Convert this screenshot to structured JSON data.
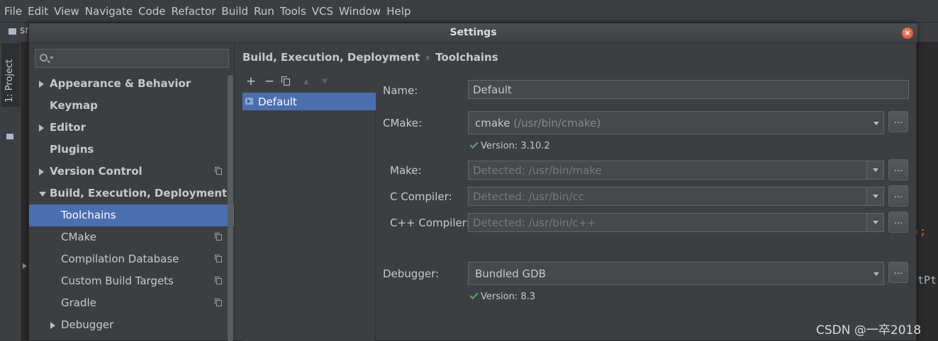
{
  "menubar": {
    "items": [
      "File",
      "Edit",
      "View",
      "Navigate",
      "Code",
      "Refactor",
      "Build",
      "Run",
      "Tools",
      "VCS",
      "Window",
      "Help"
    ]
  },
  "ide": {
    "breadcrumb_fragment": "sr",
    "project_tab_label": "1: Project",
    "editor_fragments": [
      ");",
      "tPt"
    ]
  },
  "dialog": {
    "title": "Settings",
    "close_glyph": "×"
  },
  "nav": {
    "items": [
      {
        "label": "Appearance & Behavior",
        "expander": "collapsed",
        "bold": true,
        "level": 0,
        "project_icon": false
      },
      {
        "label": "Keymap",
        "expander": "none",
        "bold": true,
        "level": 0,
        "project_icon": false
      },
      {
        "label": "Editor",
        "expander": "collapsed",
        "bold": true,
        "level": 0,
        "project_icon": false
      },
      {
        "label": "Plugins",
        "expander": "none",
        "bold": true,
        "level": 0,
        "project_icon": false
      },
      {
        "label": "Version Control",
        "expander": "collapsed",
        "bold": true,
        "level": 0,
        "project_icon": true
      },
      {
        "label": "Build, Execution, Deployment",
        "expander": "expanded",
        "bold": true,
        "level": 0,
        "project_icon": false
      },
      {
        "label": "Toolchains",
        "expander": "none",
        "bold": false,
        "level": 1,
        "project_icon": false,
        "selected": true
      },
      {
        "label": "CMake",
        "expander": "none",
        "bold": false,
        "level": 1,
        "project_icon": true
      },
      {
        "label": "Compilation Database",
        "expander": "none",
        "bold": false,
        "level": 1,
        "project_icon": true
      },
      {
        "label": "Custom Build Targets",
        "expander": "none",
        "bold": false,
        "level": 1,
        "project_icon": true
      },
      {
        "label": "Gradle",
        "expander": "none",
        "bold": false,
        "level": 1,
        "project_icon": true
      },
      {
        "label": "Debugger",
        "expander": "collapsed",
        "bold": false,
        "level": 1,
        "project_icon": false
      }
    ]
  },
  "breadcrumb": {
    "parent": "Build, Execution, Deployment",
    "separator": "›",
    "current": "Toolchains"
  },
  "toolchains": {
    "toolbar": {
      "add": "+",
      "remove": "−",
      "up": "▲",
      "down": "▼"
    },
    "items": [
      {
        "label": "Default",
        "selected": true
      }
    ]
  },
  "form": {
    "name": {
      "label": "Name:",
      "value": "Default"
    },
    "cmake": {
      "label": "CMake:",
      "value": "cmake",
      "hint": "(/usr/bin/cmake)",
      "browse": "...",
      "version": "Version: 3.10.2"
    },
    "make": {
      "label": "Make:",
      "placeholder": "Detected: /usr/bin/make",
      "browse": "..."
    },
    "c_compiler": {
      "label": "C Compiler:",
      "placeholder": "Detected: /usr/bin/cc",
      "browse": "..."
    },
    "cpp_compiler": {
      "label": "C++ Compiler:",
      "placeholder": "Detected: /usr/bin/c++",
      "browse": "..."
    },
    "debugger": {
      "label": "Debugger:",
      "value": "Bundled GDB",
      "browse": "...",
      "version": "Version: 8.3"
    }
  },
  "watermark": "CSDN @一卒2018",
  "colors": {
    "selection": "#4b6eaf",
    "panel": "#3c3f41",
    "field": "#45494a",
    "check": "#59a869",
    "close": "#d1472c"
  }
}
